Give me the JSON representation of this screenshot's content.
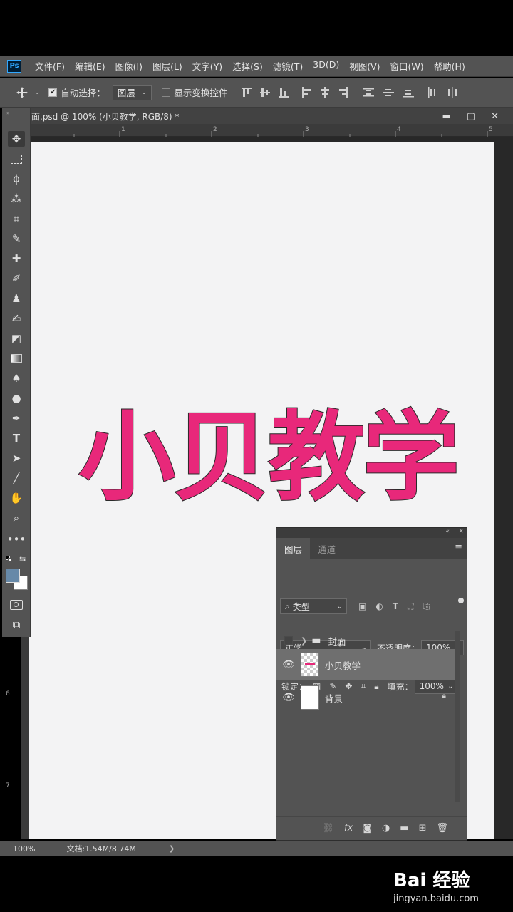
{
  "app": {
    "logo_text": "Ps",
    "menu": [
      "文件(F)",
      "编辑(E)",
      "图像(I)",
      "图层(L)",
      "文字(Y)",
      "选择(S)",
      "滤镜(T)",
      "3D(D)",
      "视图(V)",
      "窗口(W)",
      "帮助(H)"
    ]
  },
  "options_bar": {
    "auto_select_label": "自动选择：",
    "auto_select_checked": true,
    "auto_select_target": "图层",
    "show_transform_label": "显示变换控件",
    "show_transform_checked": false
  },
  "document": {
    "tab_title": "面.psd @ 100% (小贝教学, RGB/8) *",
    "ruler_top_ticks": [
      "1",
      "2",
      "3",
      "4",
      "5"
    ],
    "ruler_left_ticks": [
      "6",
      "7"
    ],
    "canvas_text": "小贝教学",
    "canvas_text_color": "#e8287a"
  },
  "status_bar": {
    "zoom": "100%",
    "doc_info": "文档:1.54M/8.74M",
    "arrow": "❯"
  },
  "layers_panel": {
    "tabs": [
      "图层",
      "通道"
    ],
    "active_tab": "图层",
    "filter_kind": "类型",
    "blend_mode": "正常",
    "opacity_label": "不透明度：",
    "opacity_value": "100%",
    "lock_label": "锁定：",
    "fill_label": "填充：",
    "fill_value": "100%",
    "layers": [
      {
        "name": "封面",
        "type": "group",
        "visible": false
      },
      {
        "name": "小贝教学",
        "type": "layer",
        "visible": true,
        "selected": true
      },
      {
        "name": "背景",
        "type": "background",
        "visible": true,
        "locked": true
      }
    ]
  },
  "watermark": {
    "logo": "Bai  经验",
    "url": "jingyan.baidu.com"
  }
}
